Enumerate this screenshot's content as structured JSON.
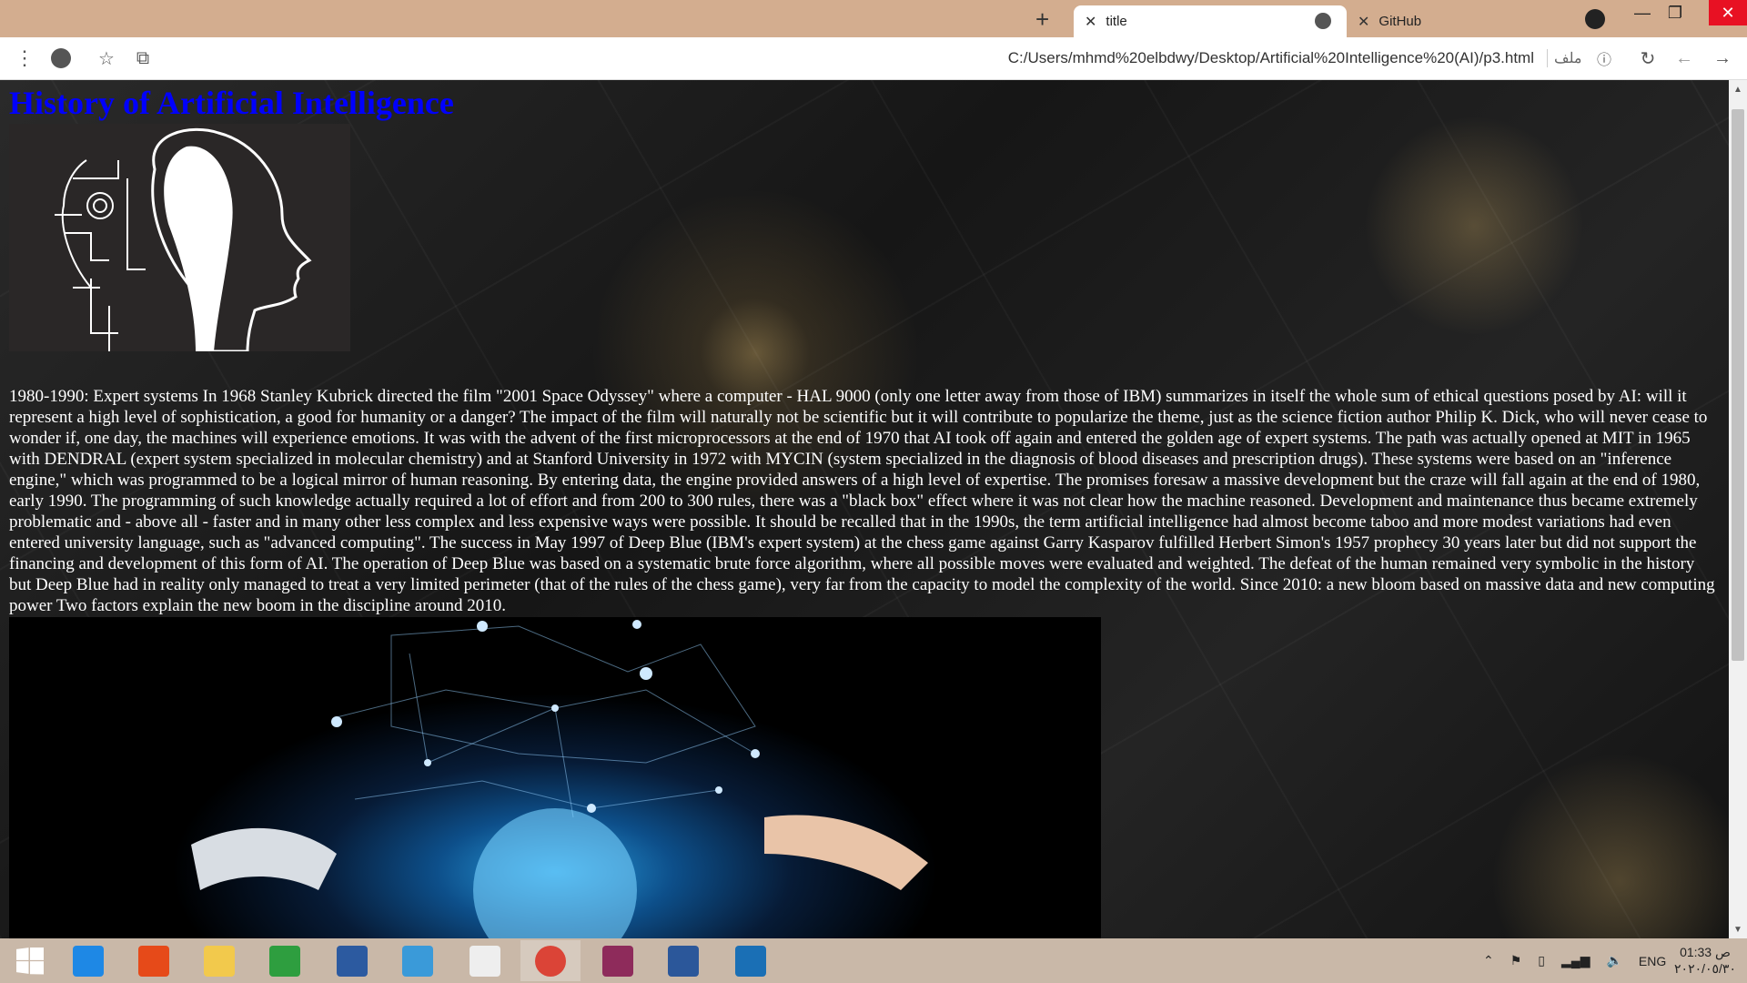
{
  "browser": {
    "tabs": [
      {
        "title": "title",
        "active": true
      },
      {
        "title": "GitHub",
        "active": false
      }
    ],
    "new_tab_symbol": "+",
    "tab_close_symbol": "✕",
    "window_controls": {
      "minimize": "—",
      "maximize": "❐",
      "close": "✕"
    },
    "url": "C:/Users/mhmd%20elbdwy/Desktop/Artificial%20Intelligence%20(AI)/p3.html",
    "file_label": "ملف",
    "icons": [
      "menu-icon",
      "profile-icon",
      "star-icon",
      "extension-icon",
      "info-icon",
      "reload-icon",
      "back-icon",
      "forward-icon",
      "github-icon",
      "globe-icon"
    ]
  },
  "page": {
    "heading": "History of Artificial Intelligence",
    "heading_color": "#0000ff",
    "article": "1980-1990: Expert systems In 1968 Stanley Kubrick directed the film \"2001 Space Odyssey\" where a computer - HAL 9000 (only one letter away from those of IBM) summarizes in itself the whole sum of ethical questions posed by AI: will it represent a high level of sophistication, a good for humanity or a danger? The impact of the film will naturally not be scientific but it will contribute to popularize the theme, just as the science fiction author Philip K. Dick, who will never cease to wonder if, one day, the machines will experience emotions. It was with the advent of the first microprocessors at the end of 1970 that AI took off again and entered the golden age of expert systems. The path was actually opened at MIT in 1965 with DENDRAL (expert system specialized in molecular chemistry) and at Stanford University in 1972 with MYCIN (system specialized in the diagnosis of blood diseases and prescription drugs). These systems were based on an \"inference engine,\" which was programmed to be a logical mirror of human reasoning. By entering data, the engine provided answers of a high level of expertise. The promises foresaw a massive development but the craze will fall again at the end of 1980, early 1990. The programming of such knowledge actually required a lot of effort and from 200 to 300 rules, there was a \"black box\" effect where it was not clear how the machine reasoned. Development and maintenance thus became extremely problematic and - above all - faster and in many other less complex and less expensive ways were possible. It should be recalled that in the 1990s, the term artificial intelligence had almost become taboo and more modest variations had even entered university language, such as \"advanced computing\". The success in May 1997 of Deep Blue (IBM's expert system) at the chess game against Garry Kasparov fulfilled Herbert Simon's 1957 prophecy 30 years later but did not support the financing and development of this form of AI. The operation of Deep Blue was based on a systematic brute force algorithm, where all possible moves were evaluated and weighted. The defeat of the human remained very symbolic in the history but Deep Blue had in reality only managed to treat a very limited perimeter (that of the rules of the chess game), very far from the capacity to model the complexity of the world. Since 2010: a new bloom based on massive data and new computing power Two factors explain the new boom in the discipline around 2010."
  },
  "taskbar": {
    "apps": [
      "start-icon",
      "internet-explorer-icon",
      "office-icon",
      "file-explorer-icon",
      "store-icon",
      "lenovo-icon",
      "mail-icon",
      "home-icon",
      "chrome-icon",
      "paint-icon",
      "word-icon",
      "app-icon"
    ],
    "app_colors": [
      "#ffffff",
      "#1e88e5",
      "#e64a19",
      "#f2c94c",
      "#2e9e3f",
      "#2c5aa0",
      "#3a9ad9",
      "#eeeeee",
      "#db4437",
      "#8e2b5b",
      "#2b579a",
      "#1a6fb5"
    ],
    "language": "ENG",
    "time": "01:33 ص",
    "date": "٢٠٢٠/٠٥/٣٠"
  }
}
